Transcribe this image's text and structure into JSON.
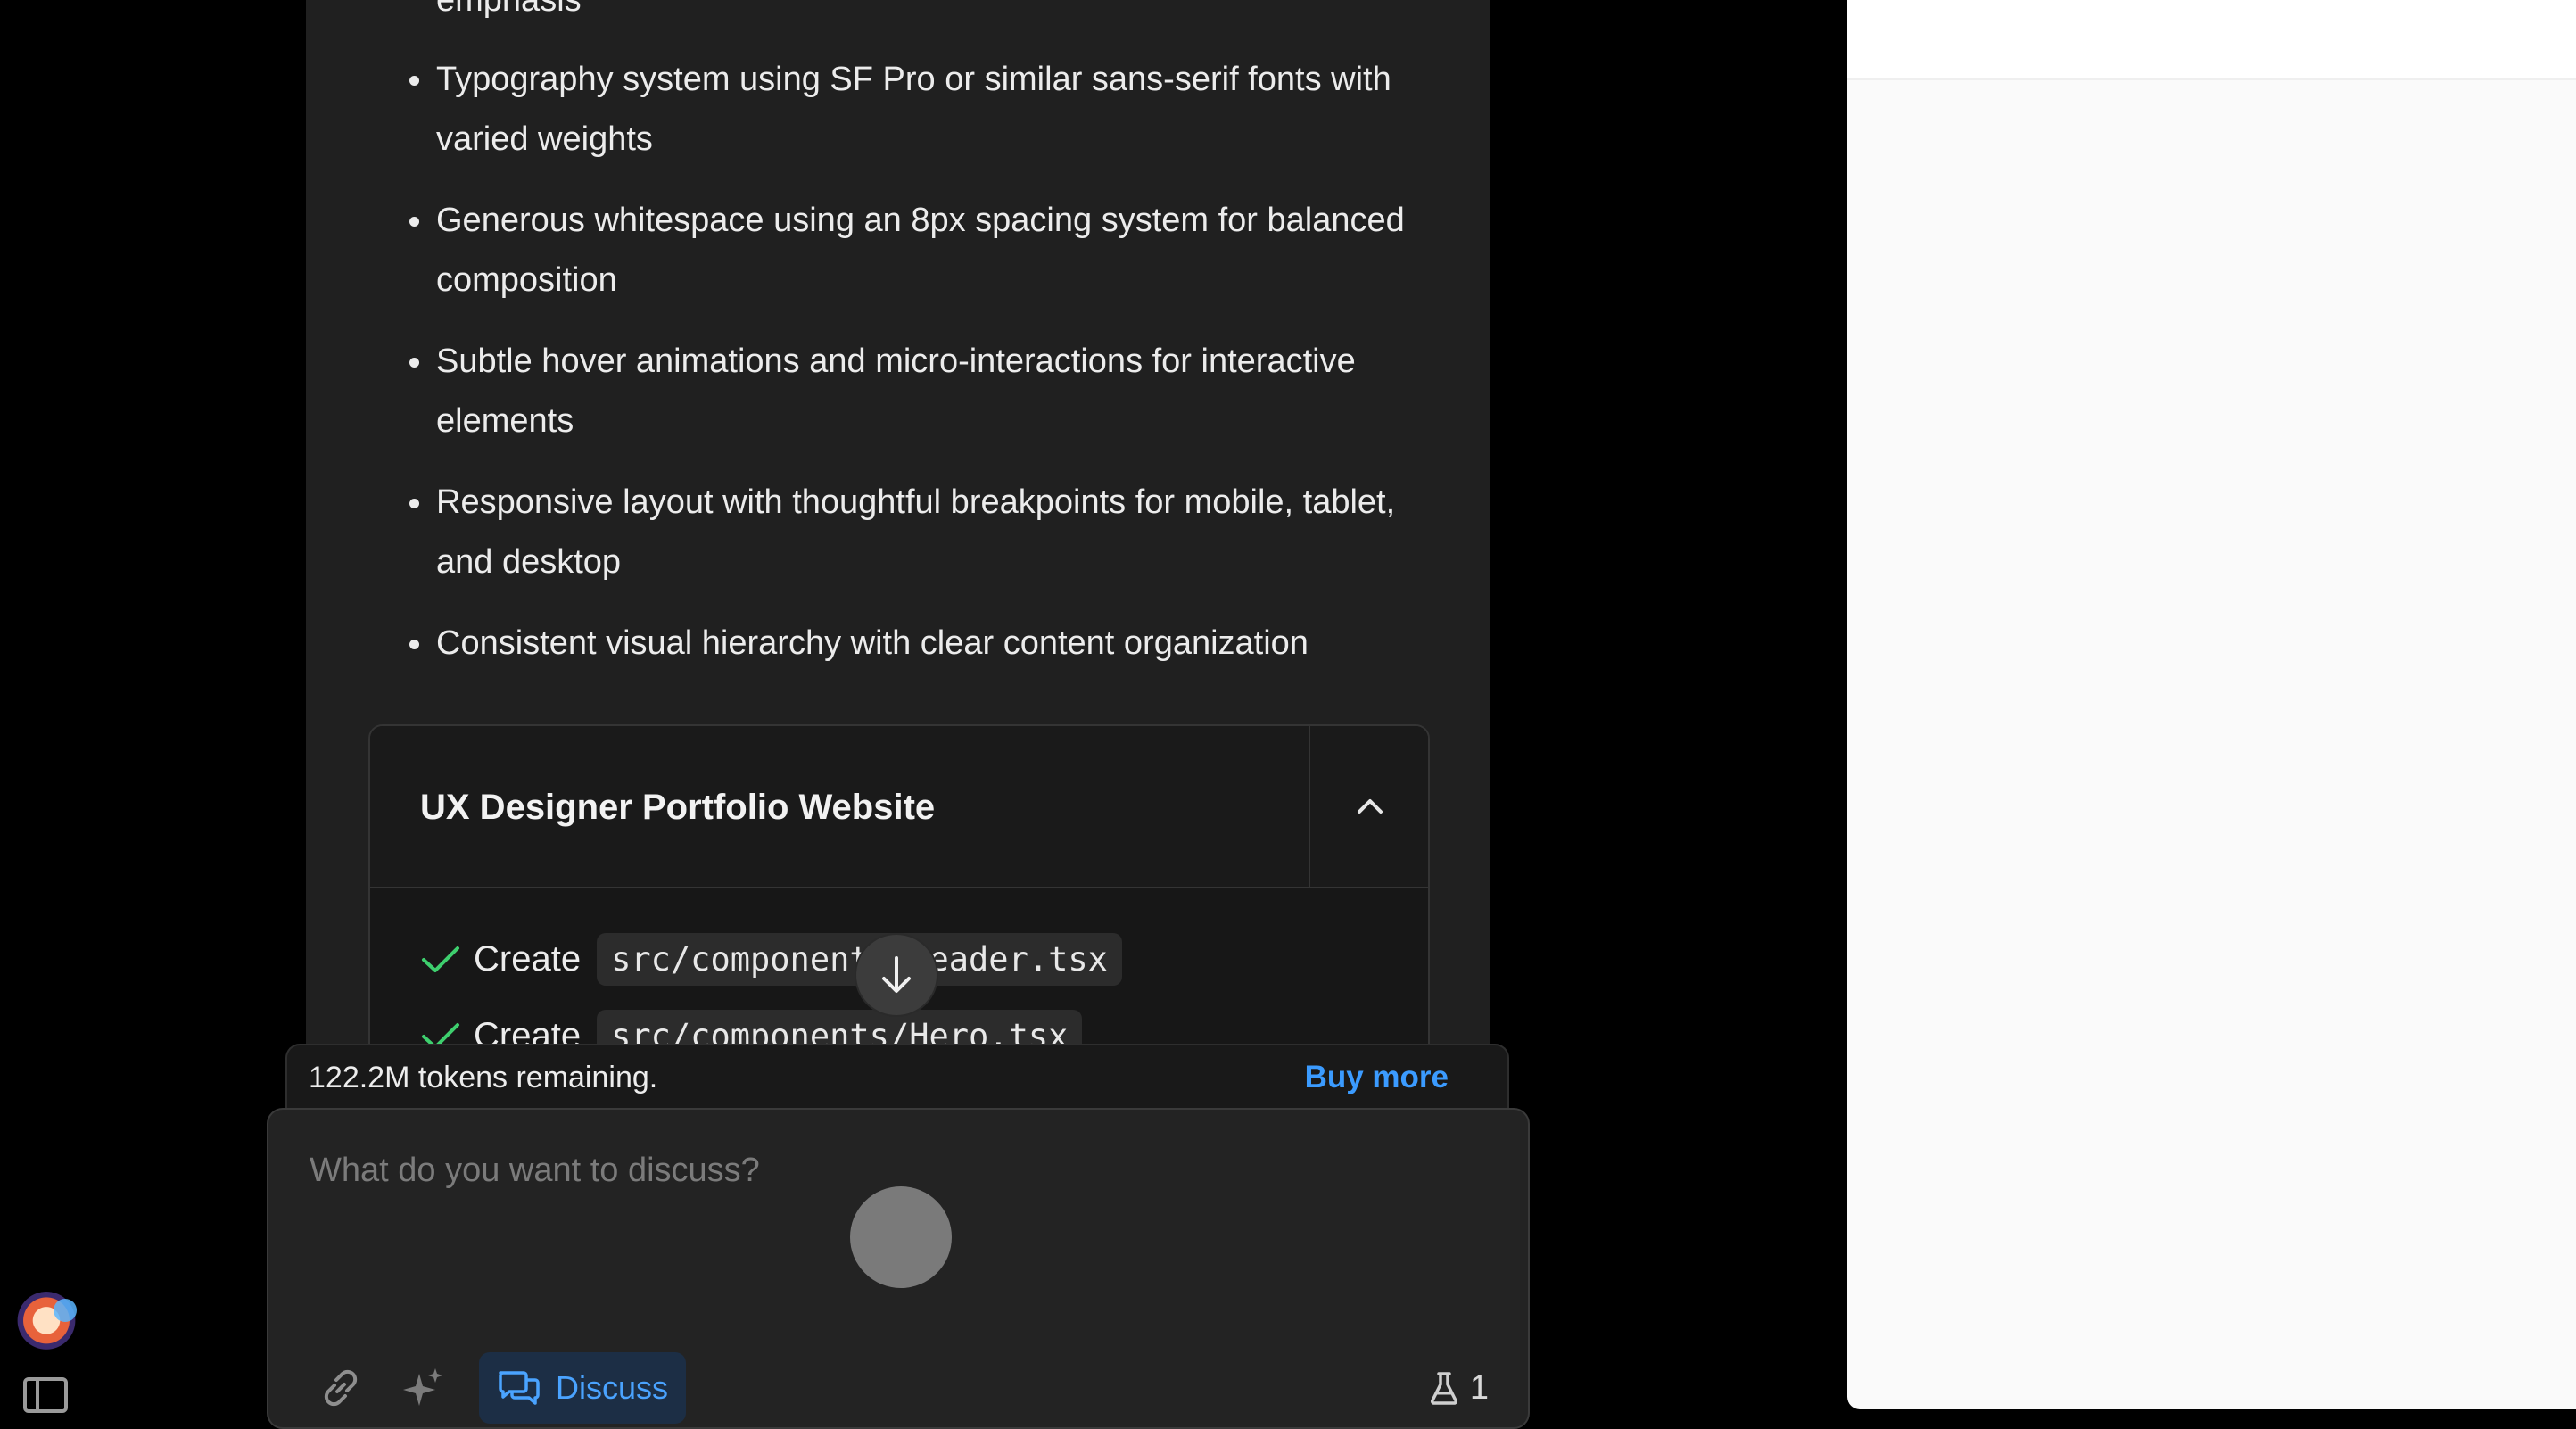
{
  "chat": {
    "partial_line": "emphasis",
    "bullets": [
      "Typography system using SF Pro or similar sans-serif fonts with varied weights",
      "Generous whitespace using an 8px spacing system for balanced composition",
      "Subtle hover animations and micro-interactions for interactive elements",
      "Responsive layout with thoughtful breakpoints for mobile, tablet, and desktop",
      "Consistent visual hierarchy with clear content organization"
    ]
  },
  "artifact": {
    "title": "UX Designer Portfolio Website",
    "actions": [
      {
        "label": "Create",
        "file": "src/components/Header.tsx"
      },
      {
        "label": "Create",
        "file": "src/components/Hero.tsx"
      }
    ]
  },
  "tokens": {
    "remaining_text": "122.2M tokens remaining.",
    "buy_more_label": "Buy more"
  },
  "prompt": {
    "placeholder": "What do you want to discuss?",
    "value": "",
    "discuss_label": "Discuss",
    "experiment_count": "1"
  },
  "icons": {
    "attach": "link-icon",
    "enhance": "sparkle-icon",
    "discuss": "chat-bubbles-icon",
    "experiments": "flask-icon",
    "collapse": "chevron-up-icon",
    "scroll": "arrow-down-icon",
    "sidebar": "sidebar-toggle-icon",
    "check": "check-icon"
  },
  "colors": {
    "accent": "#3b9bff",
    "success": "#3ecf6e",
    "chat_bg": "#202020",
    "preview_bg": "#fafafa"
  }
}
